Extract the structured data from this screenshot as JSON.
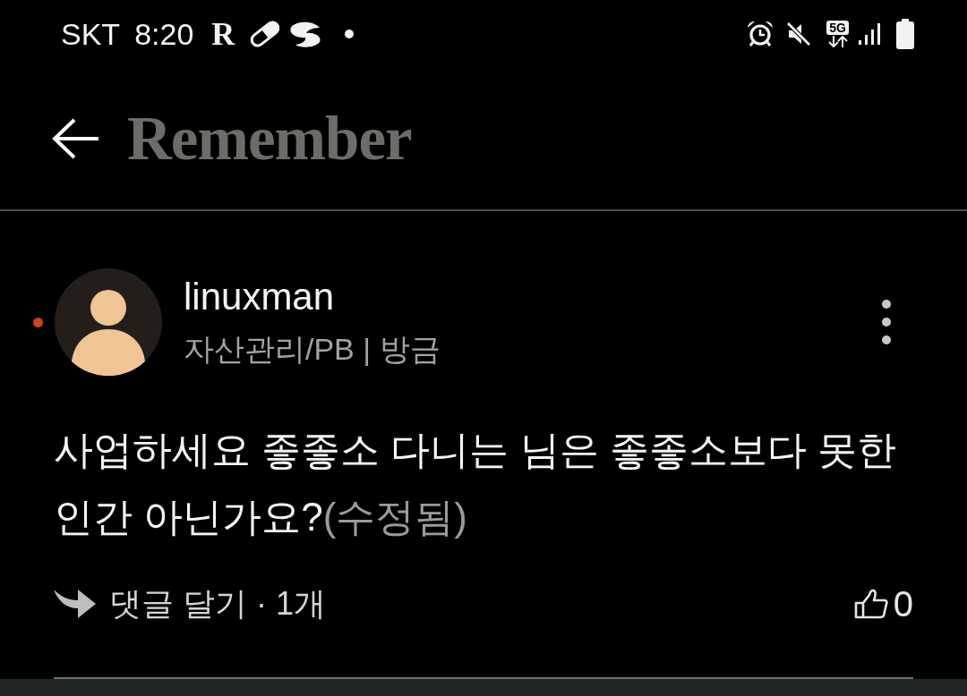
{
  "status_bar": {
    "carrier": "SKT",
    "time": "8:20",
    "app_letter": "R",
    "network_type": "5G"
  },
  "header": {
    "logo": "Remember"
  },
  "comment": {
    "unread": true,
    "author": "linuxman",
    "meta": "자산관리/PB | 방금",
    "text_lines": [
      "사업하세요 좋좋소 다니는 님은 좋좋소보다 못한",
      "인간 아닌가요?"
    ],
    "edited_label": "(수정됨)",
    "reply_label": "댓글 달기 · 1개",
    "like_count": "0"
  }
}
